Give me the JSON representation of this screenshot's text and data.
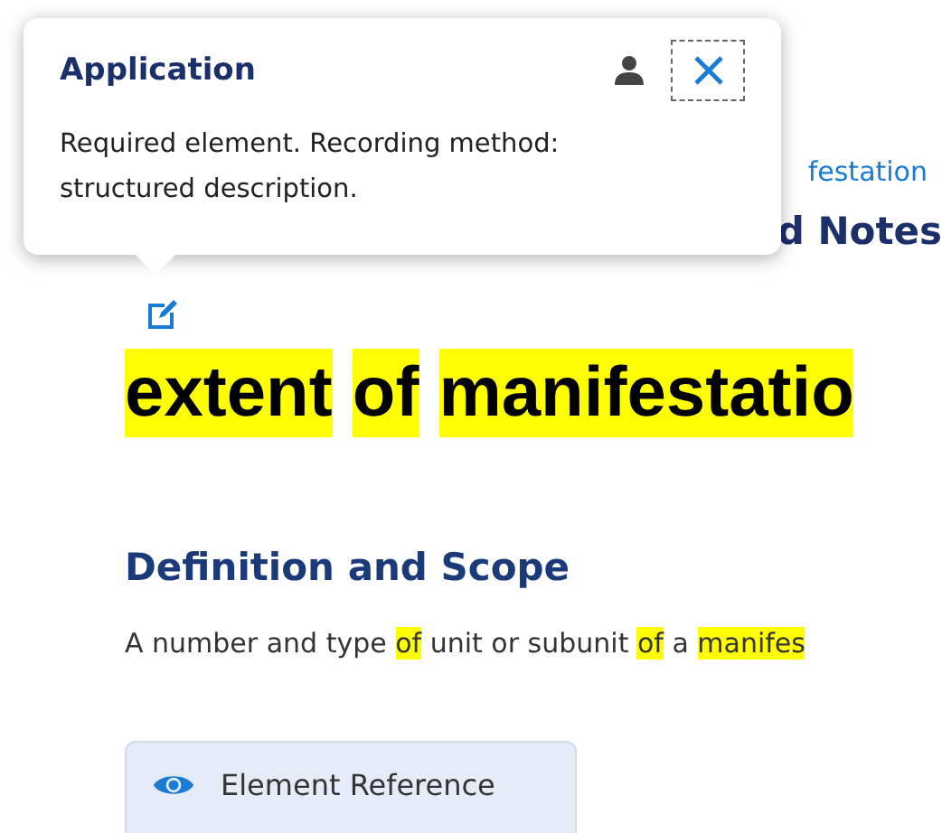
{
  "background_link": {
    "text": "festation"
  },
  "background_heading": {
    "text": "d Notes"
  },
  "popover": {
    "title": "Application",
    "body": "Required element. Recording method: structured description."
  },
  "element_title": [
    {
      "text": "extent",
      "highlighted": true
    },
    {
      "text": "of",
      "highlighted": true
    },
    {
      "text": "manifestatio",
      "highlighted": true
    }
  ],
  "definition": {
    "heading": "Definition and Scope",
    "parts": [
      {
        "text": "A number and type ",
        "highlighted": false
      },
      {
        "text": "of",
        "highlighted": true
      },
      {
        "text": " unit or subunit ",
        "highlighted": false
      },
      {
        "text": "of",
        "highlighted": true
      },
      {
        "text": " a ",
        "highlighted": false
      },
      {
        "text": "manifes",
        "highlighted": true
      }
    ]
  },
  "reference_button": {
    "label": "Element Reference"
  }
}
